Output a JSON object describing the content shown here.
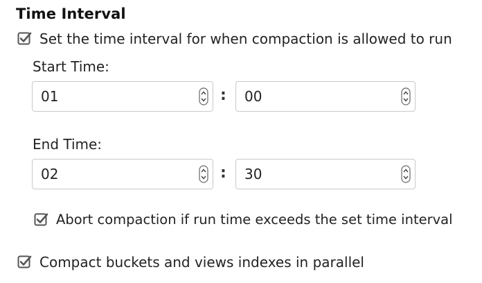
{
  "section": {
    "title": "Time Interval"
  },
  "options": {
    "time_interval": {
      "label": "Set the time interval for when compaction is allowed to run",
      "checked": true
    },
    "abort": {
      "label": "Abort compaction if run time exceeds the set time interval",
      "checked": true
    },
    "parallel": {
      "label": "Compact buckets and views indexes in parallel",
      "checked": true
    }
  },
  "start_time": {
    "label": "Start Time:",
    "hour": "01",
    "minute": "00",
    "separator": ":"
  },
  "end_time": {
    "label": "End Time:",
    "hour": "02",
    "minute": "30",
    "separator": ":"
  },
  "icons": {
    "checkbox": "checkbox-checked-icon",
    "spinner": "spinner-updown-icon"
  },
  "colors": {
    "checkbox_stroke": "#555555",
    "input_border": "#c9c9c9",
    "text": "#222222"
  }
}
